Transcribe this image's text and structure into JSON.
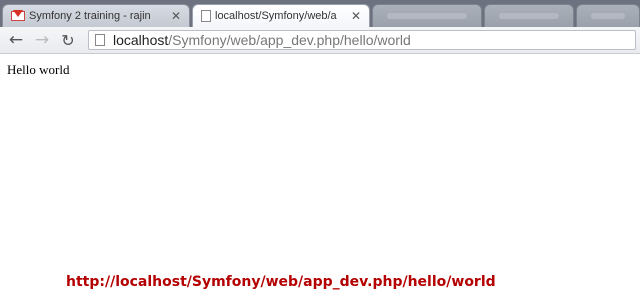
{
  "tabs": [
    {
      "title": "Symfony 2 training - rajin",
      "icon": "gmail-icon",
      "close": "✕"
    },
    {
      "title": "localhost/Symfony/web/a",
      "icon": "page-icon",
      "close": "✕"
    }
  ],
  "toolbar": {
    "back": "←",
    "forward": "→",
    "reload": "↻",
    "url_host": "localhost",
    "url_path": "/Symfony/web/app_dev.php/hello/world"
  },
  "page": {
    "body_text": "Hello world"
  },
  "caption": "http://localhost/Symfony/web/app_dev.php/hello/world",
  "colors": {
    "caption": "#b40000",
    "tabstrip": "#6d7280"
  }
}
